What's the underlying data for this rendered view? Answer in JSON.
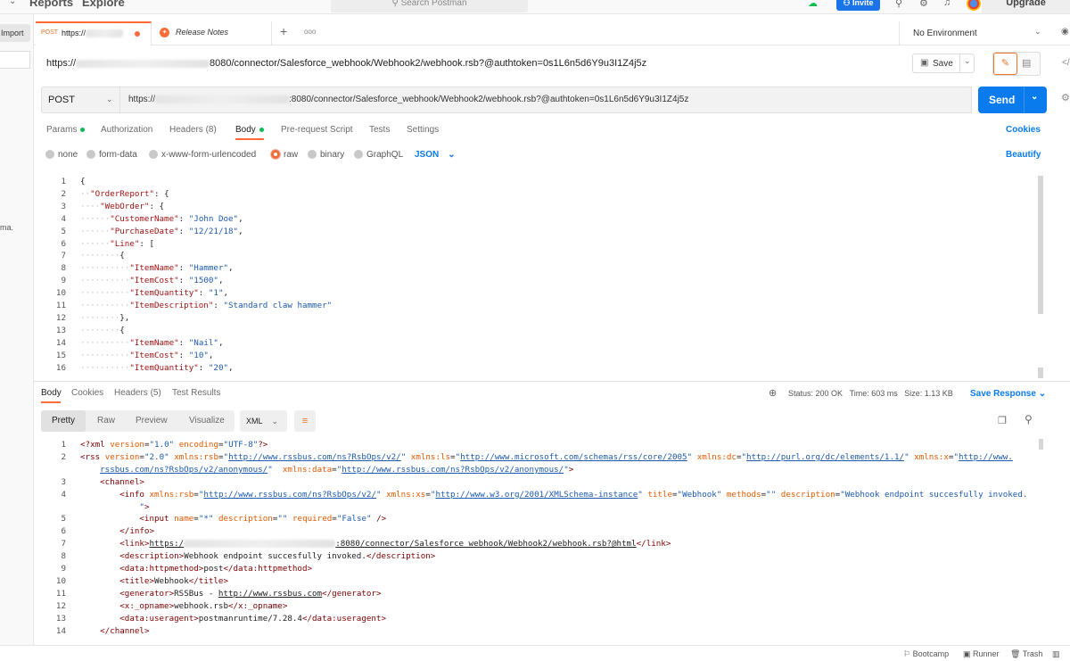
{
  "topbar": {
    "nav": [
      "Reports",
      "Explore"
    ],
    "search_placeholder": "Search Postman",
    "invite": "Invite",
    "upgrade": "Upgrade"
  },
  "sidebar": {
    "import": "Import",
    "stub_text": "ma."
  },
  "tabs": [
    {
      "method": "POST",
      "title": "https://"
    },
    {
      "title": "Release Notes"
    }
  ],
  "tab_new": "+",
  "tab_more": "ooo",
  "environment": "No Environment",
  "request_title": {
    "prefix": "https://",
    "suffix": "8080/connector/Salesforce_webhook/Webhook2/webhook.rsb?@authtoken=0s1L6n5d6Y9u3I1Z4j5z"
  },
  "save_label": "Save",
  "request": {
    "method": "POST",
    "url_prefix": "https://",
    "url_suffix": ":8080/connector/Salesforce_webhook/Webhook2/webhook.rsb?@authtoken=0s1L6n5d6Y9u3I1Z4j5z",
    "send": "Send"
  },
  "req_tabs": [
    {
      "label": "Params",
      "dot": true
    },
    {
      "label": "Authorization"
    },
    {
      "label": "Headers (8)"
    },
    {
      "label": "Body",
      "dot": true,
      "active": true
    },
    {
      "label": "Pre-request Script"
    },
    {
      "label": "Tests"
    },
    {
      "label": "Settings"
    }
  ],
  "cookies_link": "Cookies",
  "body_types": [
    {
      "label": "none"
    },
    {
      "label": "form-data"
    },
    {
      "label": "x-www-form-urlencoded"
    },
    {
      "label": "raw",
      "selected": true
    },
    {
      "label": "binary"
    },
    {
      "label": "GraphQL"
    }
  ],
  "body_format": "JSON",
  "beautify": "Beautify",
  "request_body_lines": [
    "{",
    "  \"OrderReport\": {",
    "    \"WebOrder\": {",
    "      \"CustomerName\": \"John Doe\",",
    "      \"PurchaseDate\": \"12/21/18\",",
    "      \"Line\": [",
    "        {",
    "          \"ItemName\": \"Hammer\",",
    "          \"ItemCost\": \"1500\",",
    "          \"ItemQuantity\": \"1\",",
    "          \"ItemDescription\": \"Standard claw hammer\"",
    "        },",
    "        {",
    "          \"ItemName\": \"Nail\",",
    "          \"ItemCost\": \"10\",",
    "          \"ItemQuantity\": \"20\","
  ],
  "resp_tabs": [
    "Body",
    "Cookies",
    "Headers (5)",
    "Test Results"
  ],
  "resp_status": {
    "status": "Status: 200 OK",
    "time": "Time: 603 ms",
    "size": "Size: 1.13 KB"
  },
  "save_response": "Save Response",
  "resp_views": [
    "Pretty",
    "Raw",
    "Preview",
    "Visualize"
  ],
  "resp_format": "XML",
  "response_line_numbers": [
    "1",
    "2",
    "",
    "3",
    "4",
    "",
    "5",
    "6",
    "7",
    "8",
    "9",
    "10",
    "11",
    "12",
    "13",
    "14"
  ],
  "footer": {
    "bootcamp": "Bootcamp",
    "runner": "Runner",
    "trash": "Trash"
  },
  "colors": {
    "send": "#097bed",
    "accent": "#ff6c37",
    "link": "#097bed"
  }
}
